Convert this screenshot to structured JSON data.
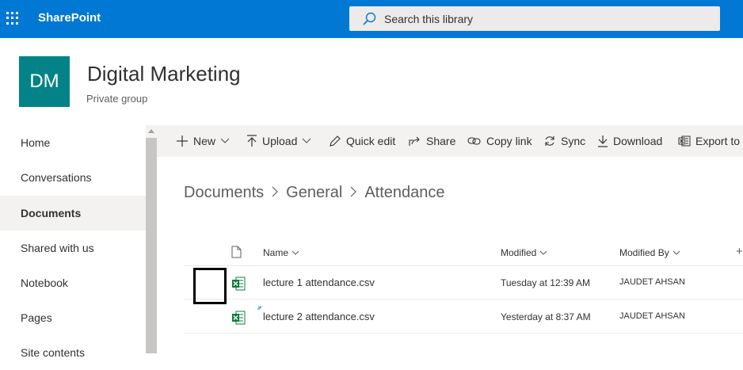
{
  "suite": {
    "brand": "SharePoint",
    "search_placeholder": "Search this library"
  },
  "site": {
    "logo_initials": "DM",
    "title": "Digital Marketing",
    "subtitle": "Private group"
  },
  "nav": {
    "items": [
      {
        "label": "Home"
      },
      {
        "label": "Conversations"
      },
      {
        "label": "Documents",
        "selected": true
      },
      {
        "label": "Shared with us"
      },
      {
        "label": "Notebook"
      },
      {
        "label": "Pages"
      },
      {
        "label": "Site contents"
      }
    ]
  },
  "commands": {
    "new": "New",
    "upload": "Upload",
    "quick_edit": "Quick edit",
    "share": "Share",
    "copy_link": "Copy link",
    "sync": "Sync",
    "download": "Download",
    "export": "Export to"
  },
  "breadcrumb": [
    "Documents",
    "General",
    "Attendance"
  ],
  "list": {
    "columns": {
      "name": "Name",
      "modified": "Modified",
      "modified_by": "Modified By",
      "add": "+"
    },
    "rows": [
      {
        "name": "lecture 1 attendance.csv",
        "modified": "Tuesday at 12:39 AM",
        "modified_by": "JAUDET AHSAN"
      },
      {
        "name": "lecture 2 attendance.csv",
        "modified": "Yesterday at 8:37 AM",
        "modified_by": "JAUDET AHSAN"
      }
    ]
  },
  "colors": {
    "suite_bar": "#0078d4",
    "logo_bg": "#038387",
    "excel_green": "#107c41"
  }
}
